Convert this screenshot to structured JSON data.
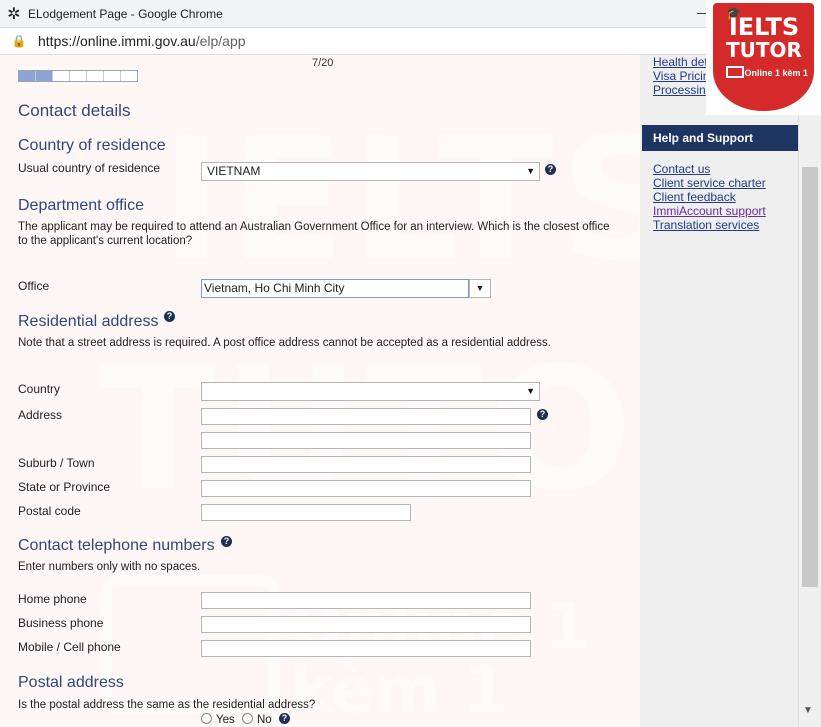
{
  "browser": {
    "window_title": "ELodgement Page - Google Chrome",
    "url_host": "https://online.immi.gov.au",
    "url_path": "/elp/app",
    "minimize_glyph": "—"
  },
  "progress": {
    "label": "7/20",
    "filled_segments": 2,
    "total_segments": 7
  },
  "contact_details": {
    "heading": "Contact details"
  },
  "country_of_residence": {
    "heading": "Country of residence",
    "label": "Usual country of residence",
    "value": "VIETNAM"
  },
  "department_office": {
    "heading": "Department office",
    "note": "The applicant may be required to attend an Australian Government Office for an interview. Which is the closest office to the applicant's current location?",
    "label": "Office",
    "value": "Vietnam, Ho Chi Minh City"
  },
  "residential_address": {
    "heading": "Residential address",
    "note": "Note that a street address is required. A post office address cannot be accepted as a residential address.",
    "country_label": "Country",
    "address_label": "Address",
    "suburb_label": "Suburb / Town",
    "state_label": "State or Province",
    "postal_label": "Postal code"
  },
  "telephone": {
    "heading": "Contact telephone numbers",
    "note": "Enter numbers only with no spaces.",
    "home_label": "Home phone",
    "business_label": "Business phone",
    "mobile_label": "Mobile / Cell phone"
  },
  "postal_address": {
    "heading": "Postal address",
    "question": "Is the postal address the same as the residential address?",
    "yes_label": "Yes",
    "no_label": "No"
  },
  "sidebar": {
    "top_links": [
      "Health det",
      "Visa Pricin",
      "Processin"
    ],
    "help_heading": "Help and Support",
    "help_links": [
      "Contact us",
      "Client service charter",
      "Client feedback",
      "ImmiAccount support",
      "Translation services"
    ]
  },
  "watermark": {
    "line1": "IELTS",
    "line2": "TUTOR",
    "line3": "Online 1 kèm 1"
  },
  "logo": {
    "line1": "IELTS",
    "line2": "TUTOR",
    "line3": "Online 1 kèm 1"
  },
  "colors": {
    "heading": "#2d4a7a",
    "help_header": "#1e3562",
    "logo_red": "#d42a2a",
    "progress_fill": "#8ea3d6"
  }
}
